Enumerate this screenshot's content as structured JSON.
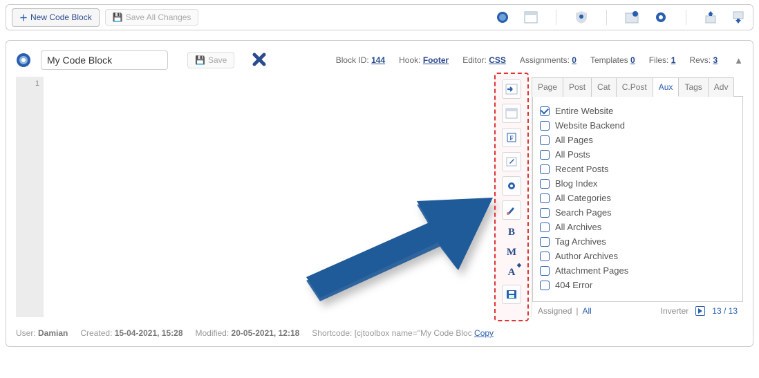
{
  "topbar": {
    "newBlock": "New Code Block",
    "saveAll": "Save All Changes"
  },
  "header": {
    "nameValue": "My Code Block",
    "saveLabel": "Save",
    "meta": {
      "blockIdLabel": "Block ID:",
      "blockId": "144",
      "hookLabel": "Hook:",
      "hook": "Footer",
      "editorLabel": "Editor:",
      "editor": "CSS",
      "assignLabel": "Assignments:",
      "assign": "0",
      "tplLabel": "Templates",
      "tpl": "0",
      "filesLabel": "Files:",
      "files": "1",
      "revsLabel": "Revs:",
      "revs": "3"
    }
  },
  "gutter": {
    "line1": "1"
  },
  "toolLetters": {
    "b": "B",
    "m": "M",
    "a": "A"
  },
  "tabs": {
    "list": [
      "Page",
      "Post",
      "Cat",
      "C.Post",
      "Aux",
      "Tags",
      "Adv"
    ],
    "active": 4
  },
  "aux": {
    "items": [
      {
        "label": "Entire Website",
        "checked": true
      },
      {
        "label": "Website Backend",
        "checked": false
      },
      {
        "label": "All Pages",
        "checked": false
      },
      {
        "label": "All Posts",
        "checked": false
      },
      {
        "label": "Recent Posts",
        "checked": false
      },
      {
        "label": "Blog Index",
        "checked": false
      },
      {
        "label": "All Categories",
        "checked": false
      },
      {
        "label": "Search Pages",
        "checked": false
      },
      {
        "label": "All Archives",
        "checked": false
      },
      {
        "label": "Tag Archives",
        "checked": false
      },
      {
        "label": "Author Archives",
        "checked": false
      },
      {
        "label": "Attachment Pages",
        "checked": false
      },
      {
        "label": "404 Error",
        "checked": false
      }
    ]
  },
  "rightFooter": {
    "assigned": "Assigned",
    "sep": "|",
    "all": "All",
    "inverter": "Inverter",
    "count": "13 / 13"
  },
  "footer": {
    "userLabel": "User:",
    "user": "Damian",
    "createdLabel": "Created:",
    "created": "15-04-2021, 15:28",
    "modifiedLabel": "Modified:",
    "modified": "20-05-2021, 12:18",
    "shortcodeLabel": "Shortcode:",
    "shortcode": "[cjtoolbox name=\"My Code Bloc",
    "copy": "Copy"
  }
}
